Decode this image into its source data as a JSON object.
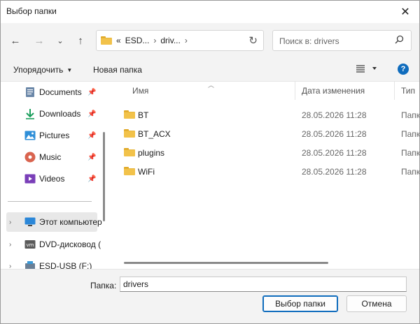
{
  "window": {
    "title": "Выбор папки",
    "close_icon": "close-icon"
  },
  "nav": {
    "back_icon": "arrow-left-icon",
    "forward_icon": "arrow-right-icon",
    "recent_icon": "chevron-down-icon",
    "up_icon": "arrow-up-icon",
    "address": {
      "prefix": "«",
      "crumbs": [
        "ESD...",
        "driv..."
      ],
      "sep": "›",
      "refresh_icon": "refresh-icon"
    },
    "search": {
      "placeholder": "Поиск в: drivers",
      "icon": "search-icon"
    }
  },
  "commandbar": {
    "organize": "Упорядочить",
    "new_folder": "Новая папка",
    "view_icon": "view-list-icon",
    "help": "?"
  },
  "sidebar": {
    "quick": [
      {
        "label": "Documents",
        "icon": "documents-icon",
        "pinned": true
      },
      {
        "label": "Downloads",
        "icon": "downloads-icon",
        "pinned": true
      },
      {
        "label": "Pictures",
        "icon": "pictures-icon",
        "pinned": true
      },
      {
        "label": "Music",
        "icon": "music-icon",
        "pinned": true
      },
      {
        "label": "Videos",
        "icon": "videos-icon",
        "pinned": true
      }
    ],
    "tree": [
      {
        "label": "Этот компьютер",
        "icon": "computer-icon",
        "selected": true
      },
      {
        "label": "DVD-дисковод (",
        "icon": "dvd-drive-icon"
      },
      {
        "label": "ESD-USB (F:)",
        "icon": "usb-drive-icon"
      }
    ]
  },
  "filelist": {
    "columns": {
      "name": "Имя",
      "date": "Дата изменения",
      "type": "Тип"
    },
    "rows": [
      {
        "name": "BT",
        "date": "28.05.2026 11:28",
        "type": "Папка"
      },
      {
        "name": "BT_ACX",
        "date": "28.05.2026 11:28",
        "type": "Папка"
      },
      {
        "name": "plugins",
        "date": "28.05.2026 11:28",
        "type": "Папка"
      },
      {
        "name": "WiFi",
        "date": "28.05.2026 11:28",
        "type": "Папка"
      }
    ]
  },
  "footer": {
    "folder_label": "Папка:",
    "folder_value": "drivers",
    "select_button": "Выбор папки",
    "cancel_button": "Отмена"
  },
  "colors": {
    "accent": "#0f6cbd",
    "folder": "#f2c24a"
  }
}
